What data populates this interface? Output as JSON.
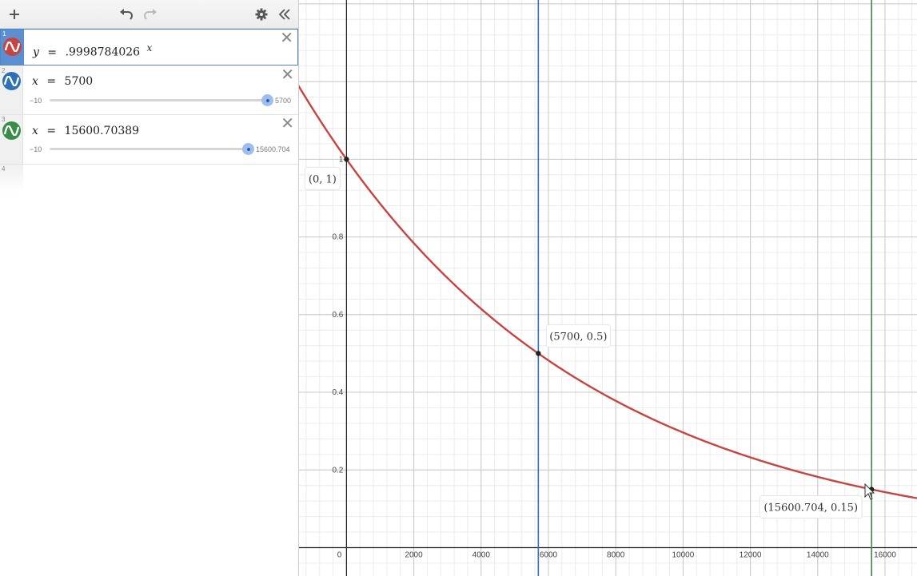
{
  "toolbar": {
    "add_icon": "plus-icon",
    "undo_icon": "undo-icon",
    "redo_icon": "redo-icon",
    "settings_icon": "gear-icon",
    "collapse_icon": "double-chevron-left-icon"
  },
  "expressions": [
    {
      "num": "1",
      "lhs": "y",
      "eq": "=",
      "rhs": ".9998784026",
      "sup": "x",
      "color": "#c74440"
    },
    {
      "num": "2",
      "lhs": "x",
      "eq": "=",
      "rhs": "5700",
      "color": "#2d70b3",
      "slider": {
        "min": "−10",
        "max": "5700"
      }
    },
    {
      "num": "3",
      "lhs": "x",
      "eq": "=",
      "rhs": "15600.70389",
      "color": "#388c46",
      "slider": {
        "min": "−10",
        "max": "15600.704"
      }
    },
    {
      "num": "4"
    }
  ],
  "chart_data": {
    "type": "line",
    "xlim": [
      -1410,
      16950
    ],
    "ylim": [
      -0.073,
      1.41
    ],
    "grid": true,
    "x_ticks": [
      0,
      2000,
      4000,
      6000,
      8000,
      10000,
      12000,
      14000,
      16000
    ],
    "x_tick_labels": [
      "0",
      "2000",
      "4000",
      "6000",
      "8000",
      "10000",
      "12000",
      "14000",
      "16000"
    ],
    "y_ticks": [
      0.2,
      0.4,
      0.6,
      0.8,
      1
    ],
    "y_tick_labels": [
      "0.2",
      "0.4",
      "0.6",
      "0.8",
      "1"
    ],
    "series": [
      {
        "expression": "y = .9998784026^x",
        "base": 0.9998784026,
        "color": "#c74440"
      },
      {
        "expression": "x = 5700",
        "vertical_x": 5700,
        "color": "#2d70b3"
      },
      {
        "expression": "x = 15600.70389",
        "vertical_x": 15600.70389,
        "color": "#388c46"
      }
    ],
    "points": [
      {
        "x": 0,
        "y": 1,
        "label": "(0, 1)"
      },
      {
        "x": 5700,
        "y": 0.5,
        "label": "(5700, 0.5)"
      },
      {
        "x": 15600.704,
        "y": 0.15,
        "label": "(15600.704, 0.15)"
      }
    ]
  }
}
